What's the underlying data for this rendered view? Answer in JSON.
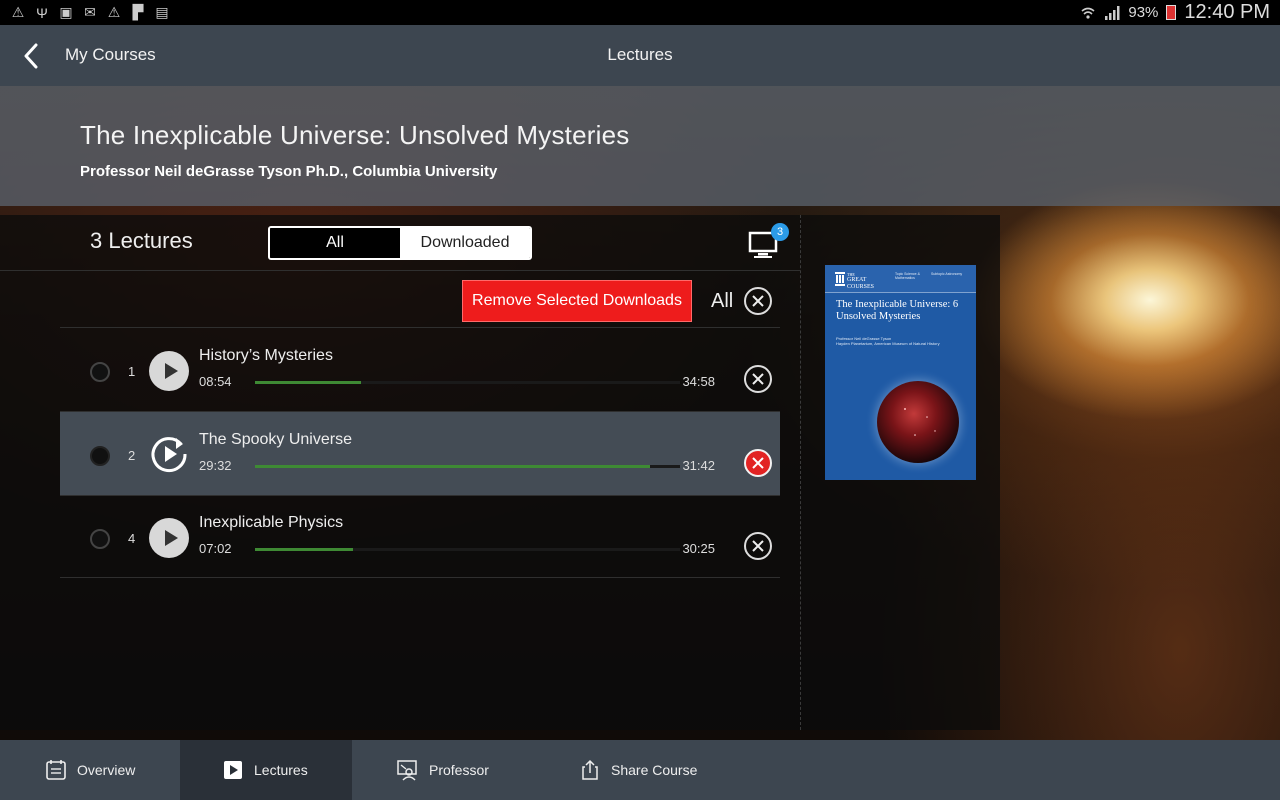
{
  "status_bar": {
    "battery": "93%",
    "time": "12:40 PM"
  },
  "topbar": {
    "back_label": "My Courses",
    "title": "Lectures"
  },
  "course": {
    "title": "The Inexplicable Universe: Unsolved Mysteries",
    "professor": "Professor Neil deGrasse Tyson Ph.D., Columbia University"
  },
  "lectures_panel": {
    "count_label": "3 Lectures",
    "filter_tabs": [
      "All",
      "Downloaded"
    ],
    "selected_filter": "All",
    "cast_badge_count": "3",
    "remove_button": "Remove Selected Downloads",
    "all_label": "All"
  },
  "lectures": [
    {
      "number": "1",
      "title": "History’s Mysteries",
      "elapsed": "08:54",
      "duration": "34:58",
      "progress": 0.25,
      "active": false
    },
    {
      "number": "2",
      "title": "The Spooky Universe",
      "elapsed": "29:32",
      "duration": "31:42",
      "progress": 0.93,
      "active": true
    },
    {
      "number": "4",
      "title": "Inexplicable Physics",
      "elapsed": "07:02",
      "duration": "30:25",
      "progress": 0.23,
      "active": false
    }
  ],
  "cover": {
    "logo_small": "THE",
    "logo_line1": "GREAT",
    "logo_line2": "COURSES",
    "meta1": "Topic Science & Mathematics",
    "meta2": "Subtopic Astronomy",
    "title": "The Inexplicable Universe: 6 Unsolved Mysteries",
    "author": "Professor Neil deGrasse Tyson\nHayden Planetarium, American Museum of Natural History"
  },
  "bottom_nav": {
    "items": [
      "Overview",
      "Lectures",
      "Professor",
      "Share Course"
    ],
    "active": "Lectures"
  },
  "colors": {
    "bar": "#3d4650",
    "remove_red": "#ee1c1c",
    "progress_green": "#3e8a34",
    "badge_blue": "#2b9be8"
  }
}
